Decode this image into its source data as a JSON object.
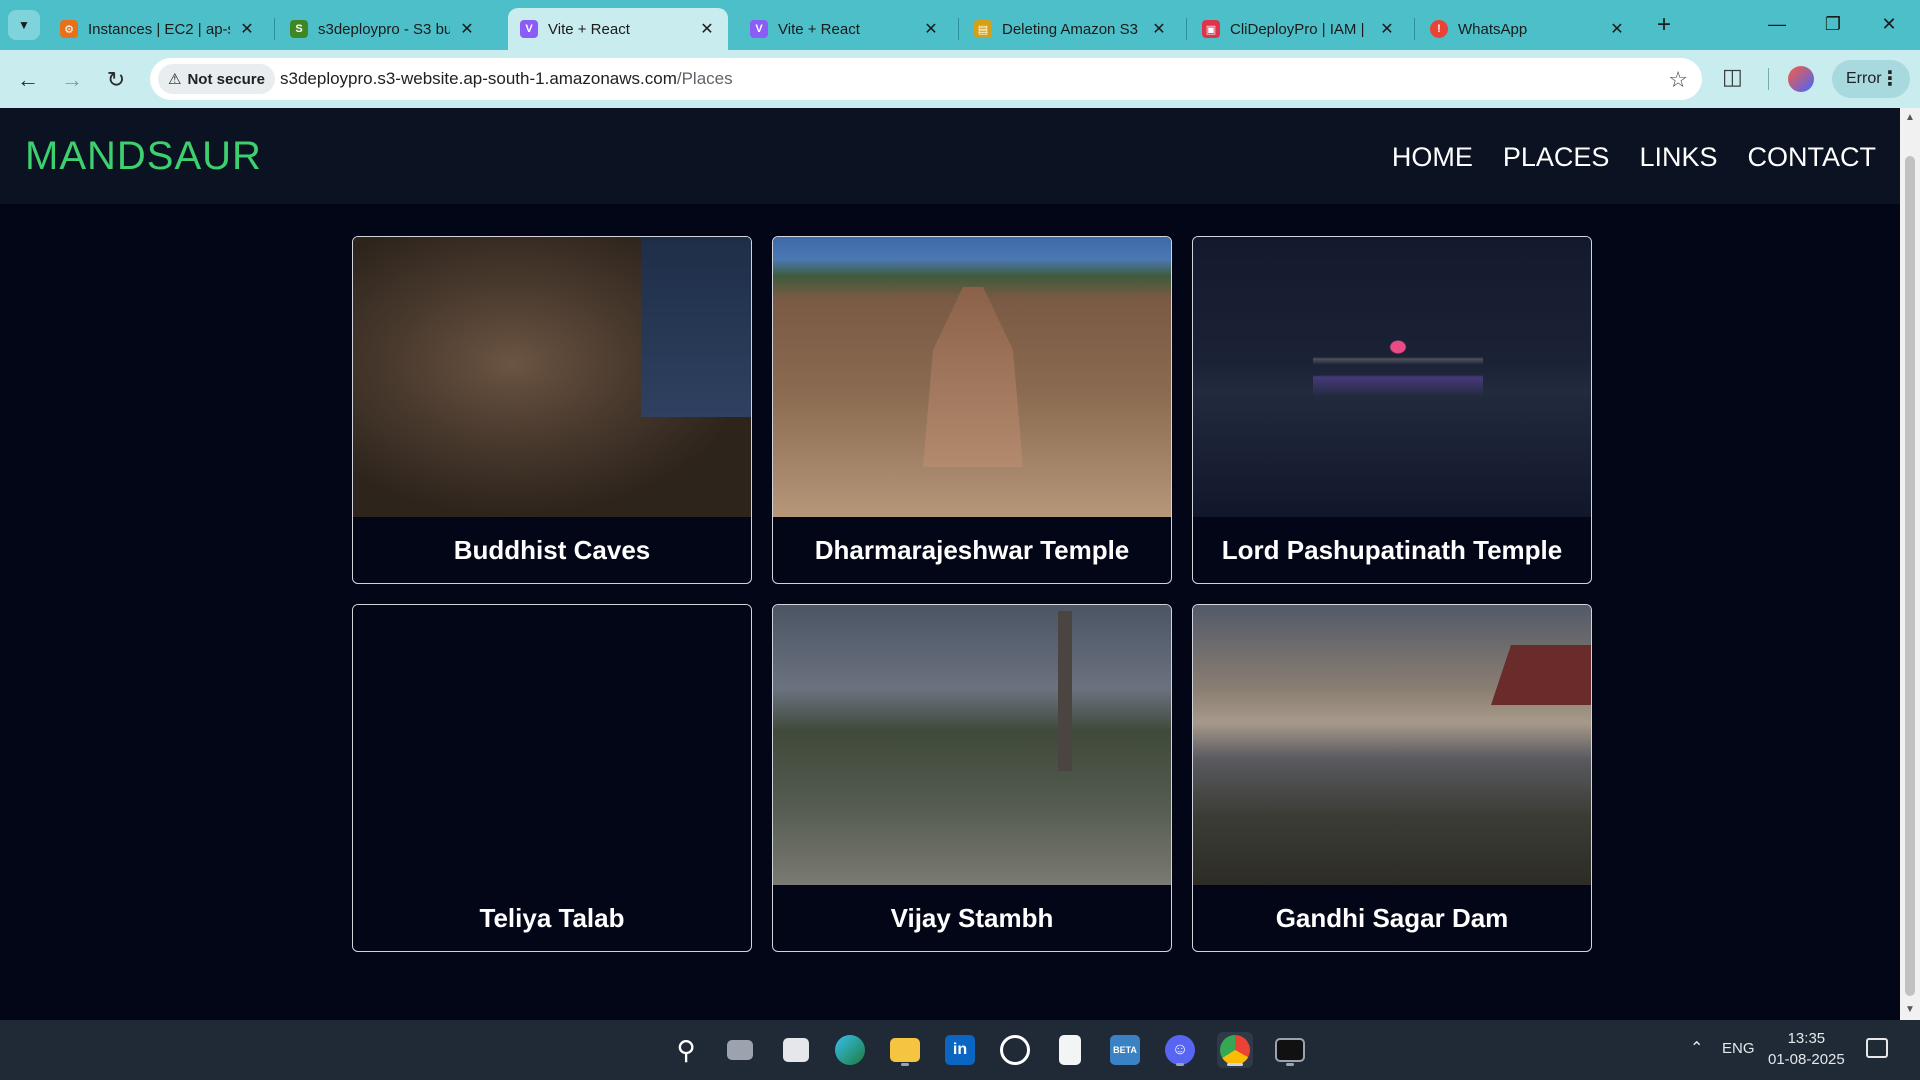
{
  "browser": {
    "tabs": [
      {
        "title": "Instances | EC2 | ap-s",
        "favicon": "aws-ec2-icon",
        "favicon_color": "#e7711b",
        "active": false
      },
      {
        "title": "s3deploypro - S3 buc",
        "favicon": "aws-s3-icon",
        "favicon_color": "#3f8624",
        "active": false
      },
      {
        "title": "Vite + React",
        "favicon": "vite-icon",
        "favicon_color": "#8b5cf6",
        "active": true
      },
      {
        "title": "Vite + React",
        "favicon": "vite-icon",
        "favicon_color": "#8b5cf6",
        "active": false
      },
      {
        "title": "Deleting Amazon S3",
        "favicon": "docs-icon",
        "favicon_color": "#d4a017",
        "active": false
      },
      {
        "title": "CliDeployPro | IAM |",
        "favicon": "aws-iam-icon",
        "favicon_color": "#dd344c",
        "active": false
      },
      {
        "title": "WhatsApp",
        "favicon": "whatsapp-notification-icon",
        "favicon_color": "#ea4335",
        "active": false
      }
    ],
    "security_label": "Not secure",
    "url_host": "s3deploypro.s3-website.ap-south-1.amazonaws.com",
    "url_path": "/Places",
    "profile_status": "Error"
  },
  "site": {
    "brand": "MANDSAUR",
    "nav": [
      "HOME",
      "PLACES",
      "LINKS",
      "CONTACT"
    ],
    "places": [
      {
        "name": "Buddhist Caves",
        "image": "cave-photo"
      },
      {
        "name": "Dharmarajeshwar Temple",
        "image": "temple-photo"
      },
      {
        "name": "Lord Pashupatinath Temple",
        "image": "night-temple-photo"
      },
      {
        "name": "Teliya Talab",
        "image": "missing-photo"
      },
      {
        "name": "Vijay Stambh",
        "image": "pillar-photo"
      },
      {
        "name": "Gandhi Sagar Dam",
        "image": "sunset-dam-photo"
      }
    ],
    "colors": {
      "brand": "#3ecf6e",
      "background": "#020617",
      "header": "#0b1222"
    }
  },
  "taskbar": {
    "apps": [
      "start-icon",
      "search-icon",
      "task-view-icon",
      "widgets-icon",
      "edge-icon",
      "file-explorer-icon",
      "linkedin-icon",
      "github-icon",
      "notepad-icon",
      "beta-app-icon",
      "discord-icon",
      "chrome-icon",
      "terminal-icon"
    ],
    "language": "ENG",
    "time": "13:35",
    "date": "01-08-2025"
  }
}
